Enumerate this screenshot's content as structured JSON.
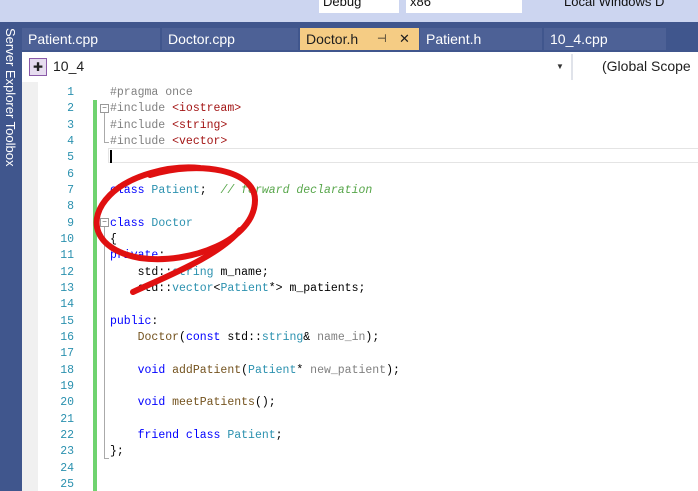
{
  "toolbar": {
    "config": "Debug",
    "platform": "x86",
    "run": "Local Windows D"
  },
  "sidebar": {
    "label": "Server Explorer   Toolbox"
  },
  "tabs": [
    {
      "label": "Patient.cpp"
    },
    {
      "label": "Doctor.cpp"
    },
    {
      "label": "Doctor.h",
      "active": true,
      "pin": "⊣",
      "close": "✕"
    },
    {
      "label": "Patient.h"
    },
    {
      "label": "10_4.cpp"
    }
  ],
  "navbar": {
    "project": "10_4",
    "scope": "(Global Scope"
  },
  "editor": {
    "current_line": 5,
    "lines": [
      [
        {
          "t": "#pragma once",
          "k": "pre"
        }
      ],
      [
        {
          "t": "#include ",
          "k": "pre"
        },
        {
          "t": "<iostream>",
          "k": "str"
        }
      ],
      [
        {
          "t": "#include ",
          "k": "pre"
        },
        {
          "t": "<string>",
          "k": "str"
        }
      ],
      [
        {
          "t": "#include ",
          "k": "pre"
        },
        {
          "t": "<vector>",
          "k": "str"
        }
      ],
      [],
      [],
      [
        {
          "t": "class ",
          "k": "keyword"
        },
        {
          "t": "Patient",
          "k": "type"
        },
        {
          "t": ";  ",
          "k": "plain"
        },
        {
          "t": "// forward declaration",
          "k": "comment"
        }
      ],
      [],
      [
        {
          "t": "class ",
          "k": "keyword"
        },
        {
          "t": "Doctor",
          "k": "type"
        }
      ],
      [
        {
          "t": "{",
          "k": "plain"
        }
      ],
      [
        {
          "t": "private",
          "k": "keyword"
        },
        {
          "t": ":",
          "k": "plain"
        }
      ],
      [
        {
          "t": "    std::",
          "k": "plain"
        },
        {
          "t": "string",
          "k": "type"
        },
        {
          "t": " m_name;",
          "k": "plain"
        }
      ],
      [
        {
          "t": "    std::",
          "k": "plain"
        },
        {
          "t": "vector",
          "k": "type"
        },
        {
          "t": "<",
          "k": "plain"
        },
        {
          "t": "Patient",
          "k": "type"
        },
        {
          "t": "*> m_patients;",
          "k": "plain"
        }
      ],
      [],
      [
        {
          "t": "public",
          "k": "keyword"
        },
        {
          "t": ":",
          "k": "plain"
        }
      ],
      [
        {
          "t": "    ",
          "k": "plain"
        },
        {
          "t": "Doctor",
          "k": "fn"
        },
        {
          "t": "(",
          "k": "plain"
        },
        {
          "t": "const ",
          "k": "keyword"
        },
        {
          "t": "std::",
          "k": "plain"
        },
        {
          "t": "string",
          "k": "type"
        },
        {
          "t": "& ",
          "k": "plain"
        },
        {
          "t": "name_in",
          "k": "param"
        },
        {
          "t": ");",
          "k": "plain"
        }
      ],
      [],
      [
        {
          "t": "    ",
          "k": "plain"
        },
        {
          "t": "void ",
          "k": "keyword"
        },
        {
          "t": "addPatient",
          "k": "fn"
        },
        {
          "t": "(",
          "k": "plain"
        },
        {
          "t": "Patient",
          "k": "type"
        },
        {
          "t": "* ",
          "k": "plain"
        },
        {
          "t": "new_patient",
          "k": "param"
        },
        {
          "t": ");",
          "k": "plain"
        }
      ],
      [],
      [
        {
          "t": "    ",
          "k": "plain"
        },
        {
          "t": "void ",
          "k": "keyword"
        },
        {
          "t": "meetPatients",
          "k": "fn"
        },
        {
          "t": "();",
          "k": "plain"
        }
      ],
      [],
      [
        {
          "t": "    ",
          "k": "plain"
        },
        {
          "t": "friend ",
          "k": "keyword"
        },
        {
          "t": "class ",
          "k": "keyword"
        },
        {
          "t": "Patient",
          "k": "type"
        },
        {
          "t": ";",
          "k": "plain"
        }
      ],
      [
        {
          "t": "};",
          "k": "plain"
        }
      ],
      [],
      []
    ]
  },
  "colors": {
    "annotation": "#e01010",
    "active_tab": "#f5cc84",
    "tab_strip": "#40568d"
  }
}
